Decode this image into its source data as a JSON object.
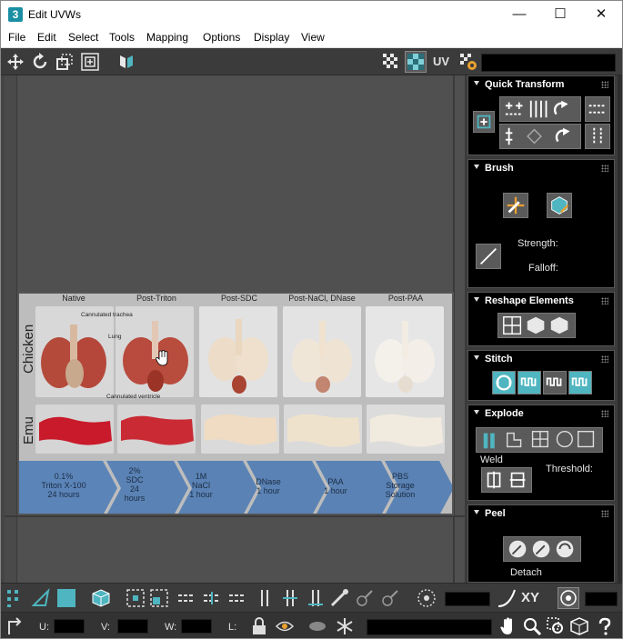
{
  "window": {
    "title": "Edit UVWs",
    "app_icon_label": "3",
    "min_label": "—",
    "max_label": "☐",
    "close_label": "✕"
  },
  "menu": [
    "File",
    "Edit",
    "Select",
    "Tools",
    "Mapping",
    "Options",
    "Display",
    "View"
  ],
  "toolbar": {
    "uv_label": "UV"
  },
  "texture": {
    "columns": [
      "Native",
      "Post-Triton",
      "Post-SDC",
      "Post-NaCl, DNase",
      "Post-PAA"
    ],
    "rows": [
      "Chicken",
      "Emu"
    ],
    "annotations": [
      "Cannulated trachea",
      "Lung",
      "Cannulated ventricle"
    ],
    "steps": [
      "0.1%\nTriton X-100\n24 hours",
      "2%\nSDC\n24\nhours",
      "1M\nNaCl\n1 hour",
      "DNase\n1 hour",
      "PAA\n1 hour",
      "PBS\nStorage\nSolution"
    ]
  },
  "panels": {
    "quick_transform": {
      "title": "Quick Transform"
    },
    "brush": {
      "title": "Brush",
      "strength_label": "Strength:",
      "falloff_label": "Falloff:"
    },
    "reshape": {
      "title": "Reshape Elements"
    },
    "stitch": {
      "title": "Stitch"
    },
    "explode": {
      "title": "Explode",
      "weld_label": "Weld",
      "threshold_label": "Threshold:"
    },
    "peel": {
      "title": "Peel",
      "detach_label": "Detach"
    }
  },
  "statusbar": {
    "xy_label": "XY",
    "u_label": "U:",
    "v_label": "V:",
    "w_label": "W:",
    "l_label": "L:"
  },
  "colors": {
    "accent": "#4fb5c0",
    "panel_bg": "#000000",
    "chrome": "#3b3b3b",
    "step_blue": "#5b84b8"
  }
}
